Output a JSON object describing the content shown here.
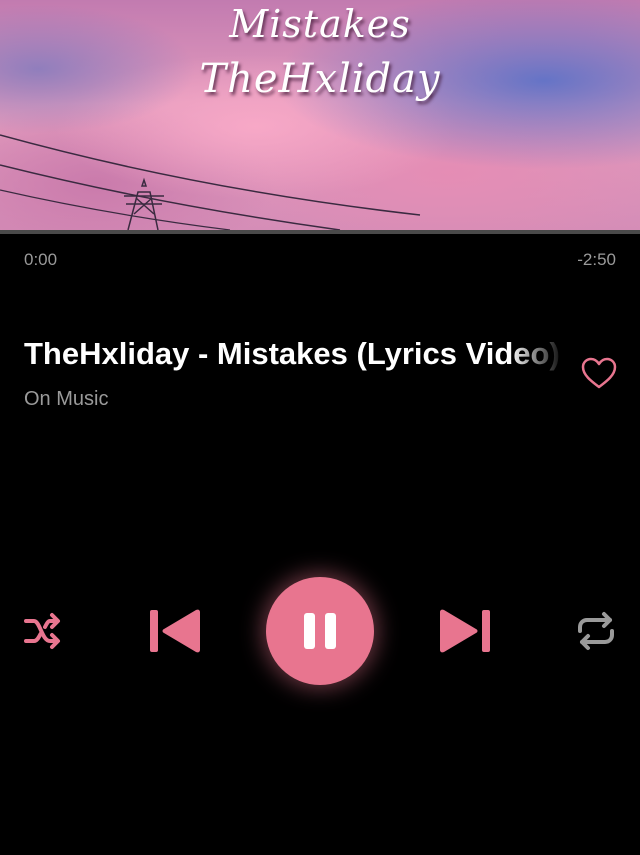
{
  "artwork": {
    "title_line1": "Mistakes",
    "title_line2": "TheHxliday"
  },
  "progress": {
    "elapsed": "0:00",
    "remaining": "-2:50",
    "fraction": 0.0
  },
  "track": {
    "title": "TheHxliday - Mistakes (Lyrics Video)",
    "artist": "On Music",
    "liked": false
  },
  "controls": {
    "shuffle_icon": "shuffle-icon",
    "previous_icon": "skip-previous-icon",
    "play_pause_icon": "pause-icon",
    "next_icon": "skip-next-icon",
    "repeat_icon": "repeat-icon"
  },
  "colors": {
    "accent": "#e8758f",
    "background": "#000000",
    "secondary_text": "#9a9a9a",
    "repeat_inactive": "#9a9a9a"
  }
}
